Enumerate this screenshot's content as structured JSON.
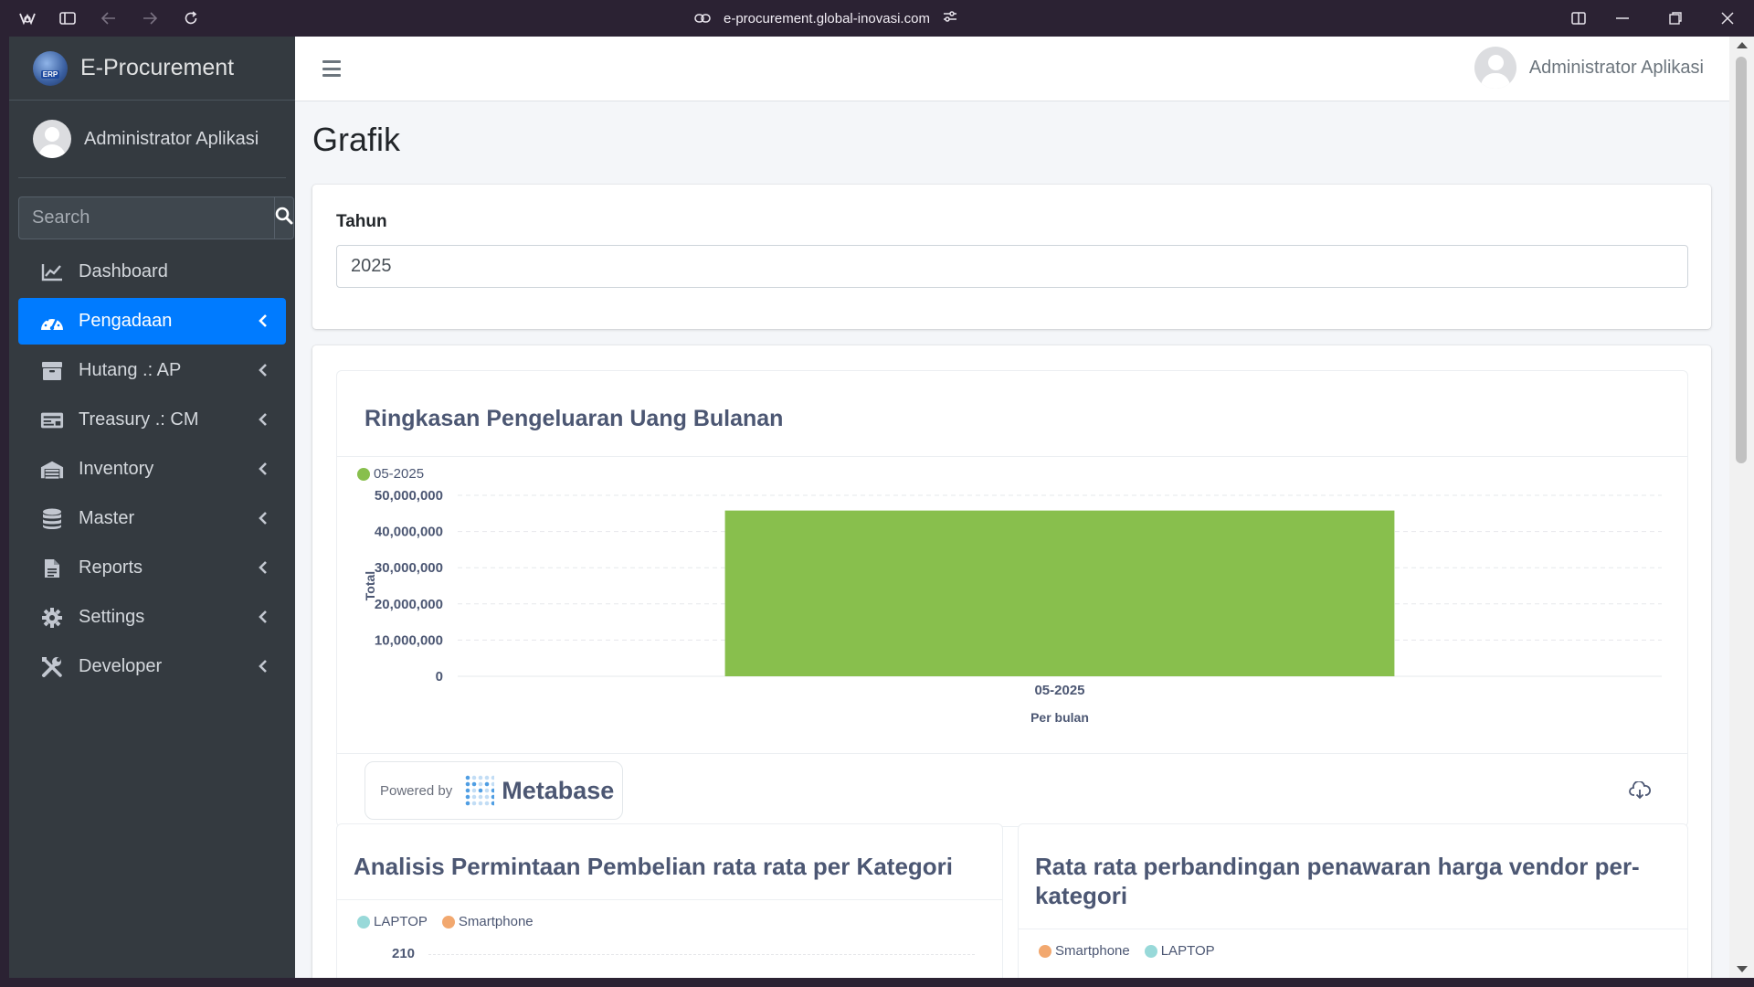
{
  "browser": {
    "url": "e-procurement.global-inovasi.com"
  },
  "sidebar": {
    "brand": "E-Procurement",
    "brand_badge": "ERP",
    "user_name": "Administrator Aplikasi",
    "search_placeholder": "Search",
    "items": [
      {
        "label": "Dashboard",
        "icon": "chart-line-icon",
        "active": false
      },
      {
        "label": "Pengadaan",
        "icon": "tachometer-icon",
        "active": true
      },
      {
        "label": "Hutang .: AP",
        "icon": "box-icon",
        "active": false
      },
      {
        "label": "Treasury .: CM",
        "icon": "money-check-icon",
        "active": false
      },
      {
        "label": "Inventory",
        "icon": "warehouse-icon",
        "active": false
      },
      {
        "label": "Master",
        "icon": "database-icon",
        "active": false
      },
      {
        "label": "Reports",
        "icon": "file-icon",
        "active": false
      },
      {
        "label": "Settings",
        "icon": "gear-icon",
        "active": false
      },
      {
        "label": "Developer",
        "icon": "tools-icon",
        "active": false
      }
    ]
  },
  "topnav": {
    "user_name": "Administrator Aplikasi"
  },
  "page": {
    "title": "Grafik",
    "year_label": "Tahun",
    "year_value": "2025"
  },
  "metabase": {
    "title": "Ringkasan Pengeluaran Uang Bulanan",
    "powered_by": "Powered by",
    "brand": "Metabase"
  },
  "chart_data": {
    "type": "bar",
    "title": "Ringkasan Pengeluaran Uang Bulanan",
    "categories": [
      "05-2025"
    ],
    "series": [
      {
        "name": "05-2025",
        "values": [
          45800000
        ],
        "color": "#88bf4d"
      }
    ],
    "xlabel": "Per bulan",
    "ylabel": "Total",
    "ylim": [
      0,
      50000000
    ],
    "yticks": [
      "0",
      "10,000,000",
      "20,000,000",
      "30,000,000",
      "40,000,000",
      "50,000,000"
    ],
    "grid": true,
    "legend": "top-left"
  },
  "cards": {
    "left_title": "Analisis Permintaan Pembelian rata rata per Kategori",
    "left_legend": [
      {
        "name": "LAPTOP",
        "color": "#98d9d9"
      },
      {
        "name": "Smartphone",
        "color": "#f2a86f"
      }
    ],
    "left_first_tick": "210",
    "right_title": "Rata rata perbandingan penawaran harga vendor per-kategori",
    "right_legend": [
      {
        "name": "Smartphone",
        "color": "#f2a86f"
      },
      {
        "name": "LAPTOP",
        "color": "#98d9d9"
      }
    ]
  }
}
